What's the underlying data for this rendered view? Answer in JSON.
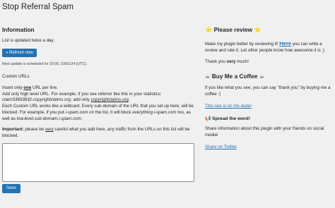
{
  "page": {
    "title": "Stop Referral Spam"
  },
  "info": {
    "title": "Information",
    "list_updated": "List is updated twice a day.",
    "refresh_button": "» Refresh now",
    "next_update": "Next update is scheduled for 20:00, 03/01/24 (UTC)."
  },
  "custom": {
    "heading": "Custom URLs",
    "l1_a": "Insert only ",
    "l1_u": "one",
    "l1_b": " URL per line.",
    "l2_a": "Add only high level URL. For example, if you see referrer like this in your statistics:",
    "l3_a": "claim53693832.copyrightclaims.org",
    "l3_b": ", add only ",
    "l3_c": "copyrightclaims.org",
    "l3_d": ".",
    "l4_a": "Each Custom URL works like a wildcard. Every sub-domain of the URL that you set up here, will be blocked. For example, if you put ",
    "l4_b": "i-spam.com",
    "l4_c": " on the list, it will block ",
    "l4_d": "everything.i-spam.com",
    "l4_e": " too, as well as ",
    "l4_f": "low.level.sub-domain.i-spam.com",
    "l4_g": ".",
    "important_label": "Important:",
    "important_a": " please be ",
    "important_u": "very",
    "important_b": " careful what you add here, any traffic from the URLs on this list will be blocked.",
    "textarea_value": "",
    "save_button": "Save"
  },
  "review": {
    "emoji": "⭐",
    "title": " Please review ",
    "text_a": "Make my plugin better by reviewing it! ",
    "here_link": "Here",
    "text_b": " you can write a review and rate it. Let other people know how awesome it is ;)",
    "thanks_a": "Thank you ",
    "thanks_bold": "very",
    "thanks_b": " much!"
  },
  "coffee": {
    "emoji": "☕",
    "title": " Buy Me a Coffee ",
    "text": "If you like what you see, you can say \"thank you\" by buying me a coffee :)",
    "link": "This one is on me dude!"
  },
  "spread": {
    "emoji": "📢",
    "title": " Spread the word!",
    "text": "Share information about this plugin with your friends on social media!",
    "link": "Share on Twitter"
  }
}
